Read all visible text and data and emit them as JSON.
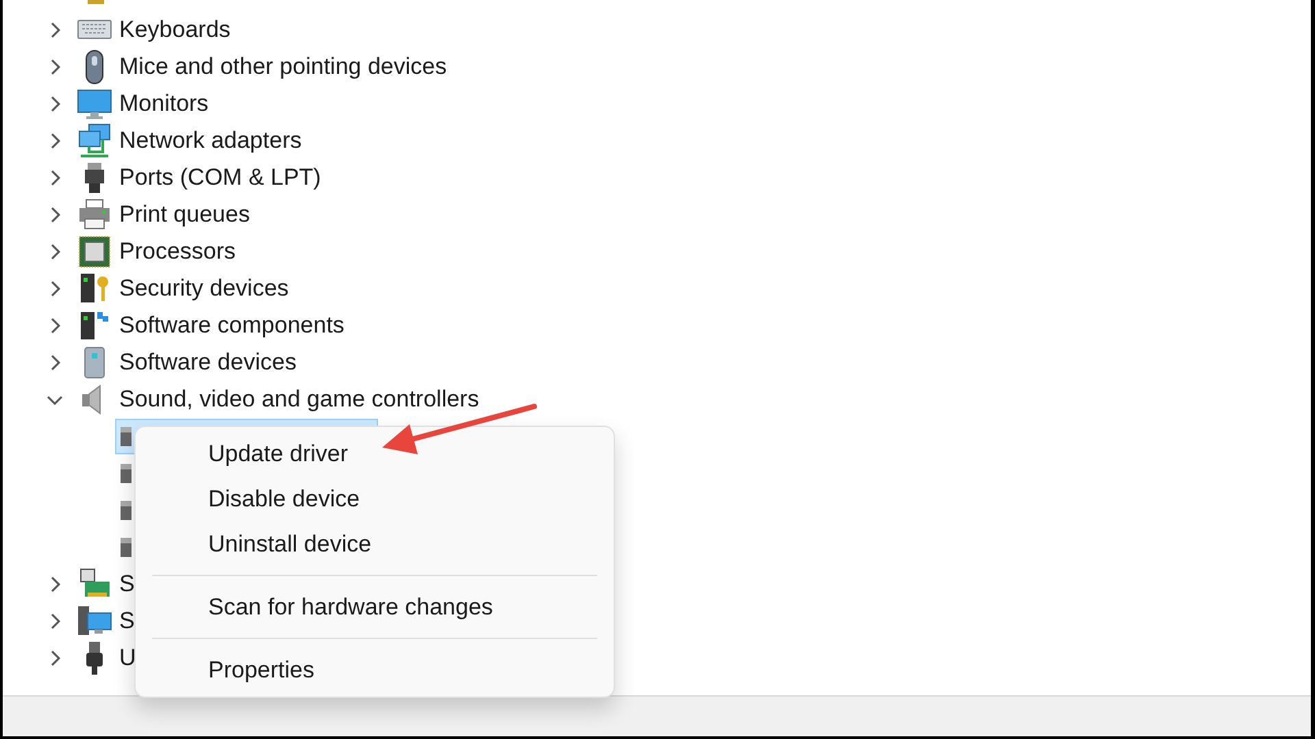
{
  "tree": [
    {
      "label": "Keyboards",
      "expanded": false
    },
    {
      "label": "Mice and other pointing devices",
      "expanded": false
    },
    {
      "label": "Monitors",
      "expanded": false
    },
    {
      "label": "Network adapters",
      "expanded": false
    },
    {
      "label": "Ports (COM & LPT)",
      "expanded": false
    },
    {
      "label": "Print queues",
      "expanded": false
    },
    {
      "label": "Processors",
      "expanded": false
    },
    {
      "label": "Security devices",
      "expanded": false
    },
    {
      "label": "Software components",
      "expanded": false
    },
    {
      "label": "Software devices",
      "expanded": false
    },
    {
      "label": "Sound, video and game controllers",
      "expanded": true,
      "children": [
        {
          "selected": true
        },
        {
          "selected": false
        },
        {
          "selected": false
        },
        {
          "selected": false
        }
      ]
    },
    {
      "label": "S",
      "expanded": false
    },
    {
      "label": "S",
      "expanded": false
    },
    {
      "label": "U",
      "expanded": false
    }
  ],
  "context_menu": [
    {
      "kind": "item",
      "label": "Update driver"
    },
    {
      "kind": "item",
      "label": "Disable device"
    },
    {
      "kind": "item",
      "label": "Uninstall device"
    },
    {
      "kind": "separator"
    },
    {
      "kind": "item",
      "label": "Scan for hardware changes"
    },
    {
      "kind": "separator"
    },
    {
      "kind": "item",
      "label": "Properties"
    }
  ]
}
